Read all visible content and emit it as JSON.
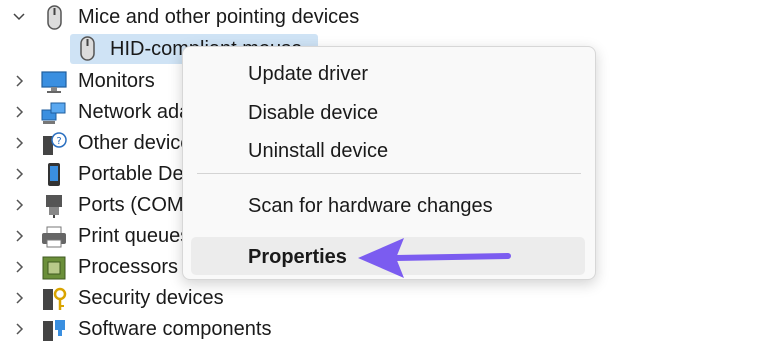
{
  "tree": {
    "expanded_category": {
      "label": "Mice and other pointing devices",
      "child": {
        "label": "HID-compliant mouse"
      }
    },
    "categories": [
      {
        "label": "Monitors",
        "icon": "monitor-icon"
      },
      {
        "label": "Network adapters",
        "icon": "network-adapter-icon"
      },
      {
        "label": "Other devices",
        "icon": "unknown-device-icon"
      },
      {
        "label": "Portable Devices",
        "icon": "portable-device-icon"
      },
      {
        "label": "Ports (COM & LPT)",
        "icon": "port-icon"
      },
      {
        "label": "Print queues",
        "icon": "printer-icon"
      },
      {
        "label": "Processors",
        "icon": "processor-icon"
      },
      {
        "label": "Security devices",
        "icon": "security-device-icon"
      },
      {
        "label": "Software components",
        "icon": "software-component-icon"
      }
    ]
  },
  "context_menu": {
    "items": [
      {
        "label": "Update driver"
      },
      {
        "label": "Disable device"
      },
      {
        "label": "Uninstall device"
      },
      {
        "label": "Scan for hardware changes"
      },
      {
        "label": "Properties"
      }
    ]
  },
  "colors": {
    "selection": "#cfe3f5",
    "menu_background": "#f9f9f9",
    "menu_hover": "#ececec",
    "arrow": "#7b5cf0"
  }
}
